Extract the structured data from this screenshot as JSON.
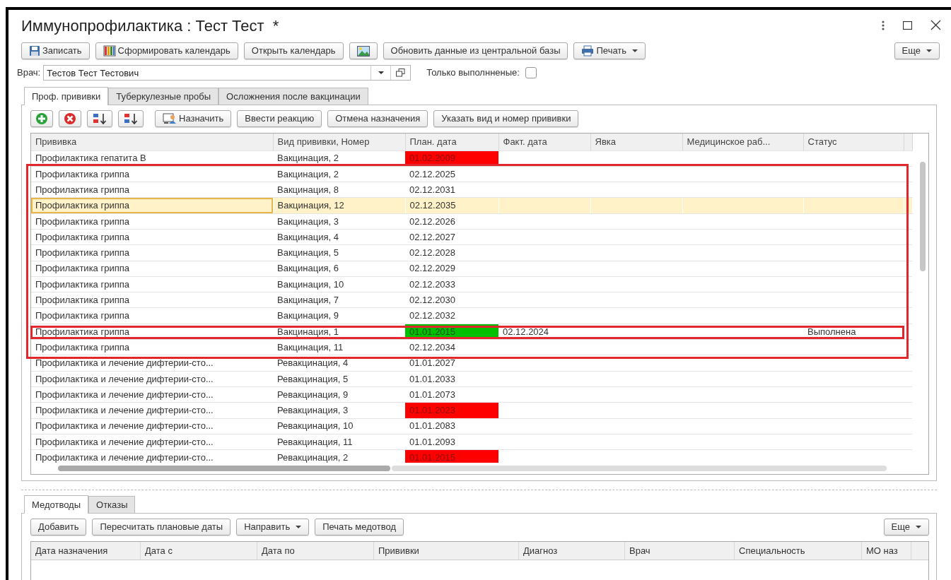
{
  "window": {
    "title": "Иммунопрофилактика : Тест Тест  *"
  },
  "toolbar": [
    {
      "kind": "save",
      "label": "Записать",
      "dropdown": false
    },
    {
      "kind": "calendar",
      "label": "Сформировать календарь",
      "dropdown": false
    },
    {
      "kind": "text",
      "label": "Открыть календарь",
      "dropdown": false
    },
    {
      "kind": "image",
      "dropdown": false
    },
    {
      "kind": "text",
      "label": "Обновить данные из центральной базы",
      "dropdown": false
    },
    {
      "kind": "print",
      "label": "Печать",
      "dropdown": true
    }
  ],
  "more_button": {
    "label": "Еще",
    "dropdown": true
  },
  "doctor": {
    "label": "Врач:",
    "value": "Тестов Тест Тестович"
  },
  "only_done": {
    "label": "Только выполнненые:",
    "checked": false
  },
  "tabs": [
    {
      "label": "Проф. прививки",
      "selected": true
    },
    {
      "label": "Туберкулезные пробы",
      "selected": false
    },
    {
      "label": "Осложнения после вакцинации",
      "selected": false
    }
  ],
  "table_toolbar": [
    {
      "kind": "add"
    },
    {
      "kind": "delete"
    },
    {
      "kind": "sort-asc"
    },
    {
      "kind": "sort-desc"
    },
    {
      "kind": "assign",
      "label": "Назначить"
    },
    {
      "kind": "text",
      "label": "Ввести реакцию"
    },
    {
      "kind": "text",
      "label": "Отмена назначения"
    },
    {
      "kind": "text",
      "label": "Указать вид и номер прививки"
    }
  ],
  "table": {
    "columns": [
      "Прививка",
      "Вид прививки, Номер",
      "План. дата",
      "Факт. дата",
      "Явка",
      "Медицинское раб...",
      "Статус"
    ],
    "row_groups": [
      {
        "outlined": false,
        "rows": [
          {
            "name": "Профилактика гепатита В",
            "type": "Вакцинация, 2",
            "plan": "01.02.2009",
            "color": "#ff0000",
            "selected": false,
            "emphasized": false
          }
        ]
      },
      {
        "outlined": true,
        "rows": [
          {
            "name": "Профилактика гриппа",
            "type": "Вакцинация, 2",
            "plan": "02.12.2025",
            "selected": false,
            "emphasized": false
          },
          {
            "name": "Профилактика гриппа",
            "type": "Вакцинация, 8",
            "plan": "02.12.2031",
            "selected": false,
            "emphasized": false
          },
          {
            "name": "Профилактика гриппа",
            "type": "Вакцинация, 12",
            "plan": "02.12.2035",
            "selected": true,
            "emphasized": false
          },
          {
            "name": "Профилактика гриппа",
            "type": "Вакцинация, 3",
            "plan": "02.12.2026",
            "selected": false,
            "emphasized": false
          },
          {
            "name": "Профилактика гриппа",
            "type": "Вакцинация, 4",
            "plan": "02.12.2027",
            "selected": false,
            "emphasized": false
          },
          {
            "name": "Профилактика гриппа",
            "type": "Вакцинация, 5",
            "plan": "02.12.2028",
            "selected": false,
            "emphasized": false
          },
          {
            "name": "Профилактика гриппа",
            "type": "Вакцинация, 6",
            "plan": "02.12.2029",
            "selected": false,
            "emphasized": false
          },
          {
            "name": "Профилактика гриппа",
            "type": "Вакцинация, 10",
            "plan": "02.12.2033",
            "selected": false,
            "emphasized": false
          },
          {
            "name": "Профилактика гриппа",
            "type": "Вакцинация, 7",
            "plan": "02.12.2030",
            "selected": false,
            "emphasized": false
          },
          {
            "name": "Профилактика гриппа",
            "type": "Вакцинация, 9",
            "plan": "02.12.2032",
            "selected": false,
            "emphasized": false
          },
          {
            "name": "Профилактика гриппа",
            "type": "Вакцинация, 1",
            "plan": "01.01.2015",
            "color": "#00c000",
            "fact": "02.12.2024",
            "status": "Выполнена",
            "selected": false,
            "emphasized": true
          },
          {
            "name": "Профилактика гриппа",
            "type": "Вакцинация, 11",
            "plan": "02.12.2034",
            "selected": false,
            "emphasized": false
          }
        ]
      },
      {
        "outlined": false,
        "rows": [
          {
            "name": "Профилактика и лечение дифтерии-сто...",
            "type": "Ревакцинация, 4",
            "plan": "01.01.2027",
            "selected": false,
            "emphasized": false
          },
          {
            "name": "Профилактика и лечение дифтерии-сто...",
            "type": "Ревакцинация, 5",
            "plan": "01.01.2033",
            "selected": false,
            "emphasized": false
          },
          {
            "name": "Профилактика и лечение дифтерии-сто...",
            "type": "Ревакцинация, 9",
            "plan": "01.01.2073",
            "selected": false,
            "emphasized": false
          },
          {
            "name": "Профилактика и лечение дифтерии-сто...",
            "type": "Ревакцинация, 3",
            "plan": "01.01.2023",
            "color": "#ff0000",
            "selected": false,
            "emphasized": false
          },
          {
            "name": "Профилактика и лечение дифтерии-сто...",
            "type": "Ревакцинация, 10",
            "plan": "01.01.2083",
            "selected": false,
            "emphasized": false
          },
          {
            "name": "Профилактика и лечение дифтерии-сто...",
            "type": "Ревакцинация, 11",
            "plan": "01.01.2093",
            "selected": false,
            "emphasized": false
          },
          {
            "name": "Профилактика и лечение дифтерии-сто...",
            "type": "Ревакцинация, 2",
            "plan": "01.01.2015",
            "color": "#ff0000",
            "selected": false,
            "emphasized": false
          }
        ]
      }
    ]
  },
  "bottom": {
    "tabs": [
      {
        "label": "Медотводы",
        "selected": true
      },
      {
        "label": "Отказы",
        "selected": false
      }
    ],
    "buttons": [
      {
        "label": "Добавить",
        "dropdown": false
      },
      {
        "label": "Пересчитать плановые даты",
        "dropdown": false
      },
      {
        "label": "Направить",
        "dropdown": true
      },
      {
        "label": "Печать медотвод",
        "dropdown": false
      }
    ],
    "more_button": {
      "label": "Еще",
      "dropdown": true
    },
    "columns": [
      "Дата назначения",
      "Дата с",
      "Дата по",
      "Прививки",
      "Диагноз",
      "Врач",
      "Специальность",
      "МО наз"
    ]
  }
}
